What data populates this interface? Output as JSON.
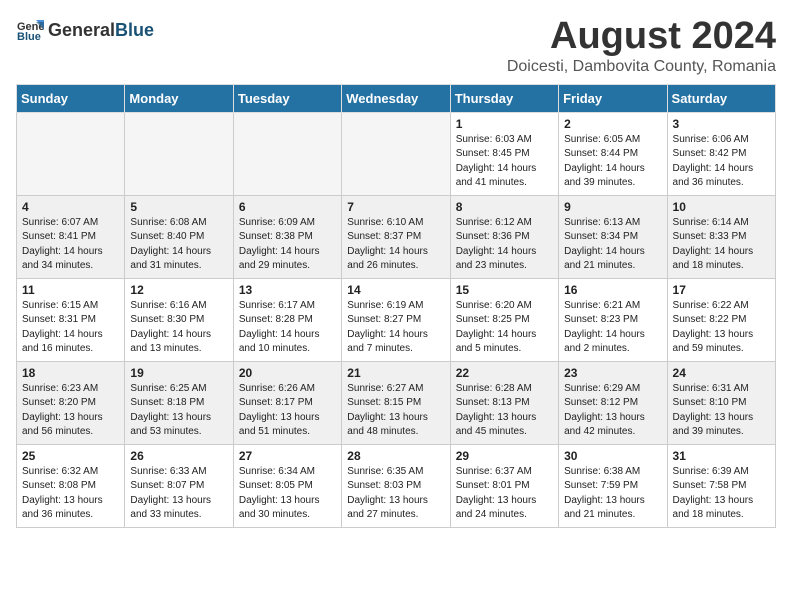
{
  "header": {
    "logo_general": "General",
    "logo_blue": "Blue",
    "month_year": "August 2024",
    "location": "Doicesti, Dambovita County, Romania"
  },
  "weekdays": [
    "Sunday",
    "Monday",
    "Tuesday",
    "Wednesday",
    "Thursday",
    "Friday",
    "Saturday"
  ],
  "weeks": [
    [
      {
        "day": "",
        "info": ""
      },
      {
        "day": "",
        "info": ""
      },
      {
        "day": "",
        "info": ""
      },
      {
        "day": "",
        "info": ""
      },
      {
        "day": "1",
        "info": "Sunrise: 6:03 AM\nSunset: 8:45 PM\nDaylight: 14 hours\nand 41 minutes."
      },
      {
        "day": "2",
        "info": "Sunrise: 6:05 AM\nSunset: 8:44 PM\nDaylight: 14 hours\nand 39 minutes."
      },
      {
        "day": "3",
        "info": "Sunrise: 6:06 AM\nSunset: 8:42 PM\nDaylight: 14 hours\nand 36 minutes."
      }
    ],
    [
      {
        "day": "4",
        "info": "Sunrise: 6:07 AM\nSunset: 8:41 PM\nDaylight: 14 hours\nand 34 minutes."
      },
      {
        "day": "5",
        "info": "Sunrise: 6:08 AM\nSunset: 8:40 PM\nDaylight: 14 hours\nand 31 minutes."
      },
      {
        "day": "6",
        "info": "Sunrise: 6:09 AM\nSunset: 8:38 PM\nDaylight: 14 hours\nand 29 minutes."
      },
      {
        "day": "7",
        "info": "Sunrise: 6:10 AM\nSunset: 8:37 PM\nDaylight: 14 hours\nand 26 minutes."
      },
      {
        "day": "8",
        "info": "Sunrise: 6:12 AM\nSunset: 8:36 PM\nDaylight: 14 hours\nand 23 minutes."
      },
      {
        "day": "9",
        "info": "Sunrise: 6:13 AM\nSunset: 8:34 PM\nDaylight: 14 hours\nand 21 minutes."
      },
      {
        "day": "10",
        "info": "Sunrise: 6:14 AM\nSunset: 8:33 PM\nDaylight: 14 hours\nand 18 minutes."
      }
    ],
    [
      {
        "day": "11",
        "info": "Sunrise: 6:15 AM\nSunset: 8:31 PM\nDaylight: 14 hours\nand 16 minutes."
      },
      {
        "day": "12",
        "info": "Sunrise: 6:16 AM\nSunset: 8:30 PM\nDaylight: 14 hours\nand 13 minutes."
      },
      {
        "day": "13",
        "info": "Sunrise: 6:17 AM\nSunset: 8:28 PM\nDaylight: 14 hours\nand 10 minutes."
      },
      {
        "day": "14",
        "info": "Sunrise: 6:19 AM\nSunset: 8:27 PM\nDaylight: 14 hours\nand 7 minutes."
      },
      {
        "day": "15",
        "info": "Sunrise: 6:20 AM\nSunset: 8:25 PM\nDaylight: 14 hours\nand 5 minutes."
      },
      {
        "day": "16",
        "info": "Sunrise: 6:21 AM\nSunset: 8:23 PM\nDaylight: 14 hours\nand 2 minutes."
      },
      {
        "day": "17",
        "info": "Sunrise: 6:22 AM\nSunset: 8:22 PM\nDaylight: 13 hours\nand 59 minutes."
      }
    ],
    [
      {
        "day": "18",
        "info": "Sunrise: 6:23 AM\nSunset: 8:20 PM\nDaylight: 13 hours\nand 56 minutes."
      },
      {
        "day": "19",
        "info": "Sunrise: 6:25 AM\nSunset: 8:18 PM\nDaylight: 13 hours\nand 53 minutes."
      },
      {
        "day": "20",
        "info": "Sunrise: 6:26 AM\nSunset: 8:17 PM\nDaylight: 13 hours\nand 51 minutes."
      },
      {
        "day": "21",
        "info": "Sunrise: 6:27 AM\nSunset: 8:15 PM\nDaylight: 13 hours\nand 48 minutes."
      },
      {
        "day": "22",
        "info": "Sunrise: 6:28 AM\nSunset: 8:13 PM\nDaylight: 13 hours\nand 45 minutes."
      },
      {
        "day": "23",
        "info": "Sunrise: 6:29 AM\nSunset: 8:12 PM\nDaylight: 13 hours\nand 42 minutes."
      },
      {
        "day": "24",
        "info": "Sunrise: 6:31 AM\nSunset: 8:10 PM\nDaylight: 13 hours\nand 39 minutes."
      }
    ],
    [
      {
        "day": "25",
        "info": "Sunrise: 6:32 AM\nSunset: 8:08 PM\nDaylight: 13 hours\nand 36 minutes."
      },
      {
        "day": "26",
        "info": "Sunrise: 6:33 AM\nSunset: 8:07 PM\nDaylight: 13 hours\nand 33 minutes."
      },
      {
        "day": "27",
        "info": "Sunrise: 6:34 AM\nSunset: 8:05 PM\nDaylight: 13 hours\nand 30 minutes."
      },
      {
        "day": "28",
        "info": "Sunrise: 6:35 AM\nSunset: 8:03 PM\nDaylight: 13 hours\nand 27 minutes."
      },
      {
        "day": "29",
        "info": "Sunrise: 6:37 AM\nSunset: 8:01 PM\nDaylight: 13 hours\nand 24 minutes."
      },
      {
        "day": "30",
        "info": "Sunrise: 6:38 AM\nSunset: 7:59 PM\nDaylight: 13 hours\nand 21 minutes."
      },
      {
        "day": "31",
        "info": "Sunrise: 6:39 AM\nSunset: 7:58 PM\nDaylight: 13 hours\nand 18 minutes."
      }
    ]
  ]
}
